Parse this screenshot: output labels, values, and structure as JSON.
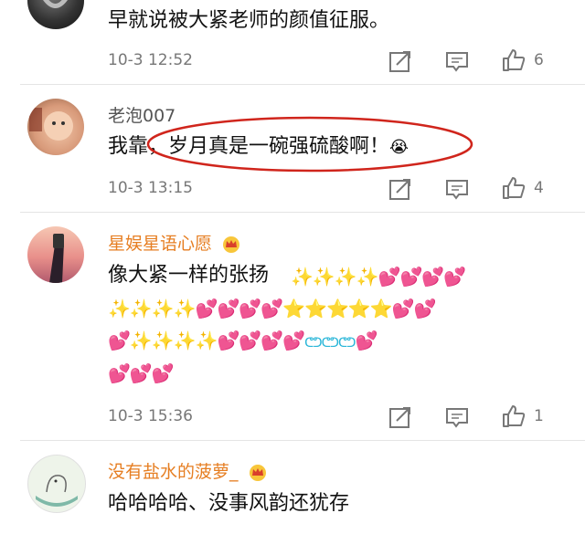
{
  "comments": [
    {
      "name": "",
      "text": "早就说被大紧老师的颜值征服。",
      "time": "10-3 12:52",
      "likes": "6"
    },
    {
      "name": "老泡007",
      "text": "我靠，岁月真是一碗强硫酸啊！",
      "emoji": "😭",
      "time": "10-3 13:15",
      "likes": "4"
    },
    {
      "name": "星娱星语心愿",
      "text": "像大紧一样的张扬",
      "row1": "✨✨✨✨💕💕💕💕",
      "row2": "✨✨✨✨💕💕💕💕⭐⭐⭐⭐⭐💕💕",
      "row3": "💕✨✨✨✨💕💕💕💕",
      "row3b": "ᕦᕤᕦᕤᕦᕤ",
      "row3c": "💕",
      "row4": "💕💕💕",
      "time": "10-3 15:36",
      "likes": "1"
    },
    {
      "name": "没有盐水的菠萝_",
      "text": "哈哈哈哈、没事风韵还犹存"
    }
  ],
  "colors": {
    "vip_name": "#e67e22",
    "plain_name": "#555555",
    "highlight_oval": "#d0251c"
  }
}
